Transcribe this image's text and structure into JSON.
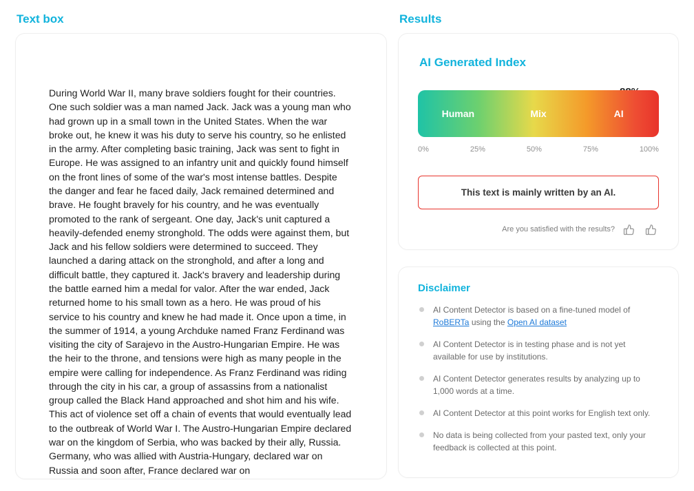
{
  "left": {
    "title": "Text box",
    "body": "During World War II, many brave soldiers fought for their countries. One such soldier was a man named Jack. Jack was a young man who had grown up in a small town in the United States. When the war broke out, he knew it was his duty to serve his country, so he enlisted in the army. After completing basic training, Jack was sent to fight in Europe. He was assigned to an infantry unit and quickly found himself on the front lines of some of the war's most intense battles. Despite the danger and fear he faced daily, Jack remained determined and brave. He fought bravely for his country, and he was eventually promoted to the rank of sergeant. One day, Jack's unit captured a heavily-defended enemy stronghold. The odds were against them, but Jack and his fellow soldiers were determined to succeed. They launched a daring attack on the stronghold, and after a long and difficult battle, they captured it. Jack's bravery and leadership during the battle earned him a medal for valor. After the war ended, Jack returned home to his small town as a hero. He was proud of his service to his country and knew he had made it. Once upon a time, in the summer of 1914, a young Archduke named Franz Ferdinand was visiting the city of Sarajevo in the Austro-Hungarian Empire. He was the heir to the throne, and tensions were high as many people in the empire were calling for independence. As Franz Ferdinand was riding through the city in his car, a group of assassins from a nationalist group called the Black Hand approached and shot him and his wife. This act of violence set off a chain of events that would eventually lead to the outbreak of World War I. The Austro-Hungarian Empire declared war on the kingdom of Serbia, who was backed by their ally, Russia. Germany, who was allied with Austria-Hungary, declared war on Russia and soon after, France declared war on"
  },
  "right": {
    "title": "Results",
    "index_heading": "AI Generated Index",
    "percent_label": "88%",
    "gauge": {
      "human": "Human",
      "mix": "Mix",
      "ai": "AI"
    },
    "axis": {
      "p0": "0%",
      "p25": "25%",
      "p50": "50%",
      "p75": "75%",
      "p100": "100%"
    },
    "verdict": "This text is mainly written by an AI.",
    "feedback_prompt": "Are you satisfied with the results?"
  },
  "disclaimer": {
    "heading": "Disclaimer",
    "items": {
      "i1a": "AI Content Detector is based on a fine-tuned model of ",
      "i1_link1": "RoBERTa",
      "i1b": " using the ",
      "i1_link2": "Open AI dataset",
      "i2": "AI Content Detector is in testing phase and is not yet available for use by institutions.",
      "i3": "AI Content Detector generates results by analyzing up to 1,000 words at a time.",
      "i4": "AI Content Detector at this point works for English text only.",
      "i5": "No data is being collected from your pasted text, only your feedback is collected at this point."
    }
  },
  "chart_data": {
    "type": "bar",
    "title": "AI Generated Index",
    "categories": [
      "Human",
      "Mix",
      "AI"
    ],
    "value": 88,
    "xlabel": "",
    "ylabel": "",
    "xlim": [
      0,
      100
    ],
    "ticks": [
      0,
      25,
      50,
      75,
      100
    ],
    "pointer_label": "88%",
    "verdict": "This text is mainly written by an AI."
  }
}
